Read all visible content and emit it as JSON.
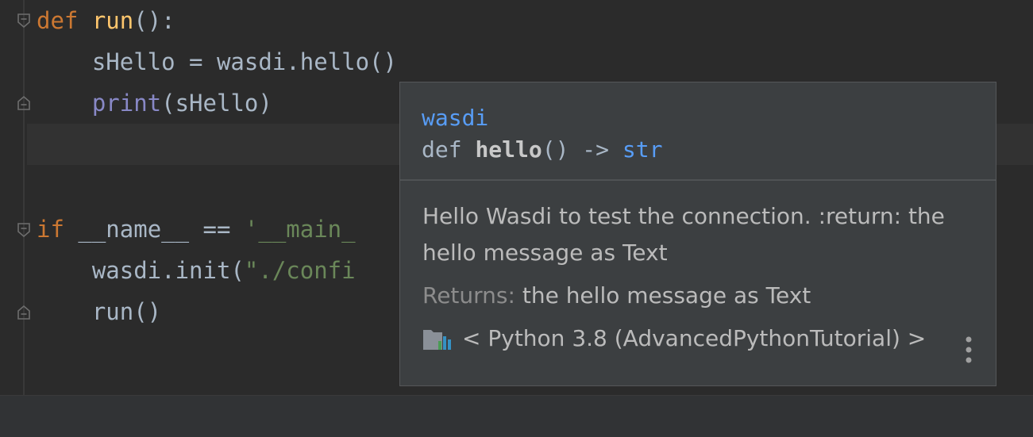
{
  "editor": {
    "lines": [
      {
        "kw": "def ",
        "fn": "run",
        "rest": "():"
      },
      {
        "text": "    sHello = wasdi.hello()"
      },
      {
        "builtin": "    print",
        "rest": "(sHello)"
      },
      {
        "text": ""
      },
      {
        "text": ""
      },
      {
        "kw": "if ",
        "pre": "__name__ == ",
        "str": "'__main_"
      },
      {
        "pre": "    wasdi.init(",
        "str": "\"./confi"
      },
      {
        "text": "    run()"
      }
    ]
  },
  "popup": {
    "module": "wasdi",
    "signature": {
      "def": "def ",
      "name": "hello",
      "params": "() -> ",
      "return_type": "str"
    },
    "description": "Hello Wasdi to test the connection. :return: the hello message as Text",
    "returns_label": "Returns:",
    "returns_value": " the hello message as Text",
    "interpreter": "< Python 3.8 (AdvancedPythonTutorial) >",
    "icons": {
      "interpreter": "python-sdk-icon",
      "more": "more-vertical-icon"
    }
  },
  "colors": {
    "keyword": "#cc7832",
    "function": "#ffc66d",
    "builtin": "#8888c6",
    "string": "#6a8759",
    "link": "#589df6"
  }
}
